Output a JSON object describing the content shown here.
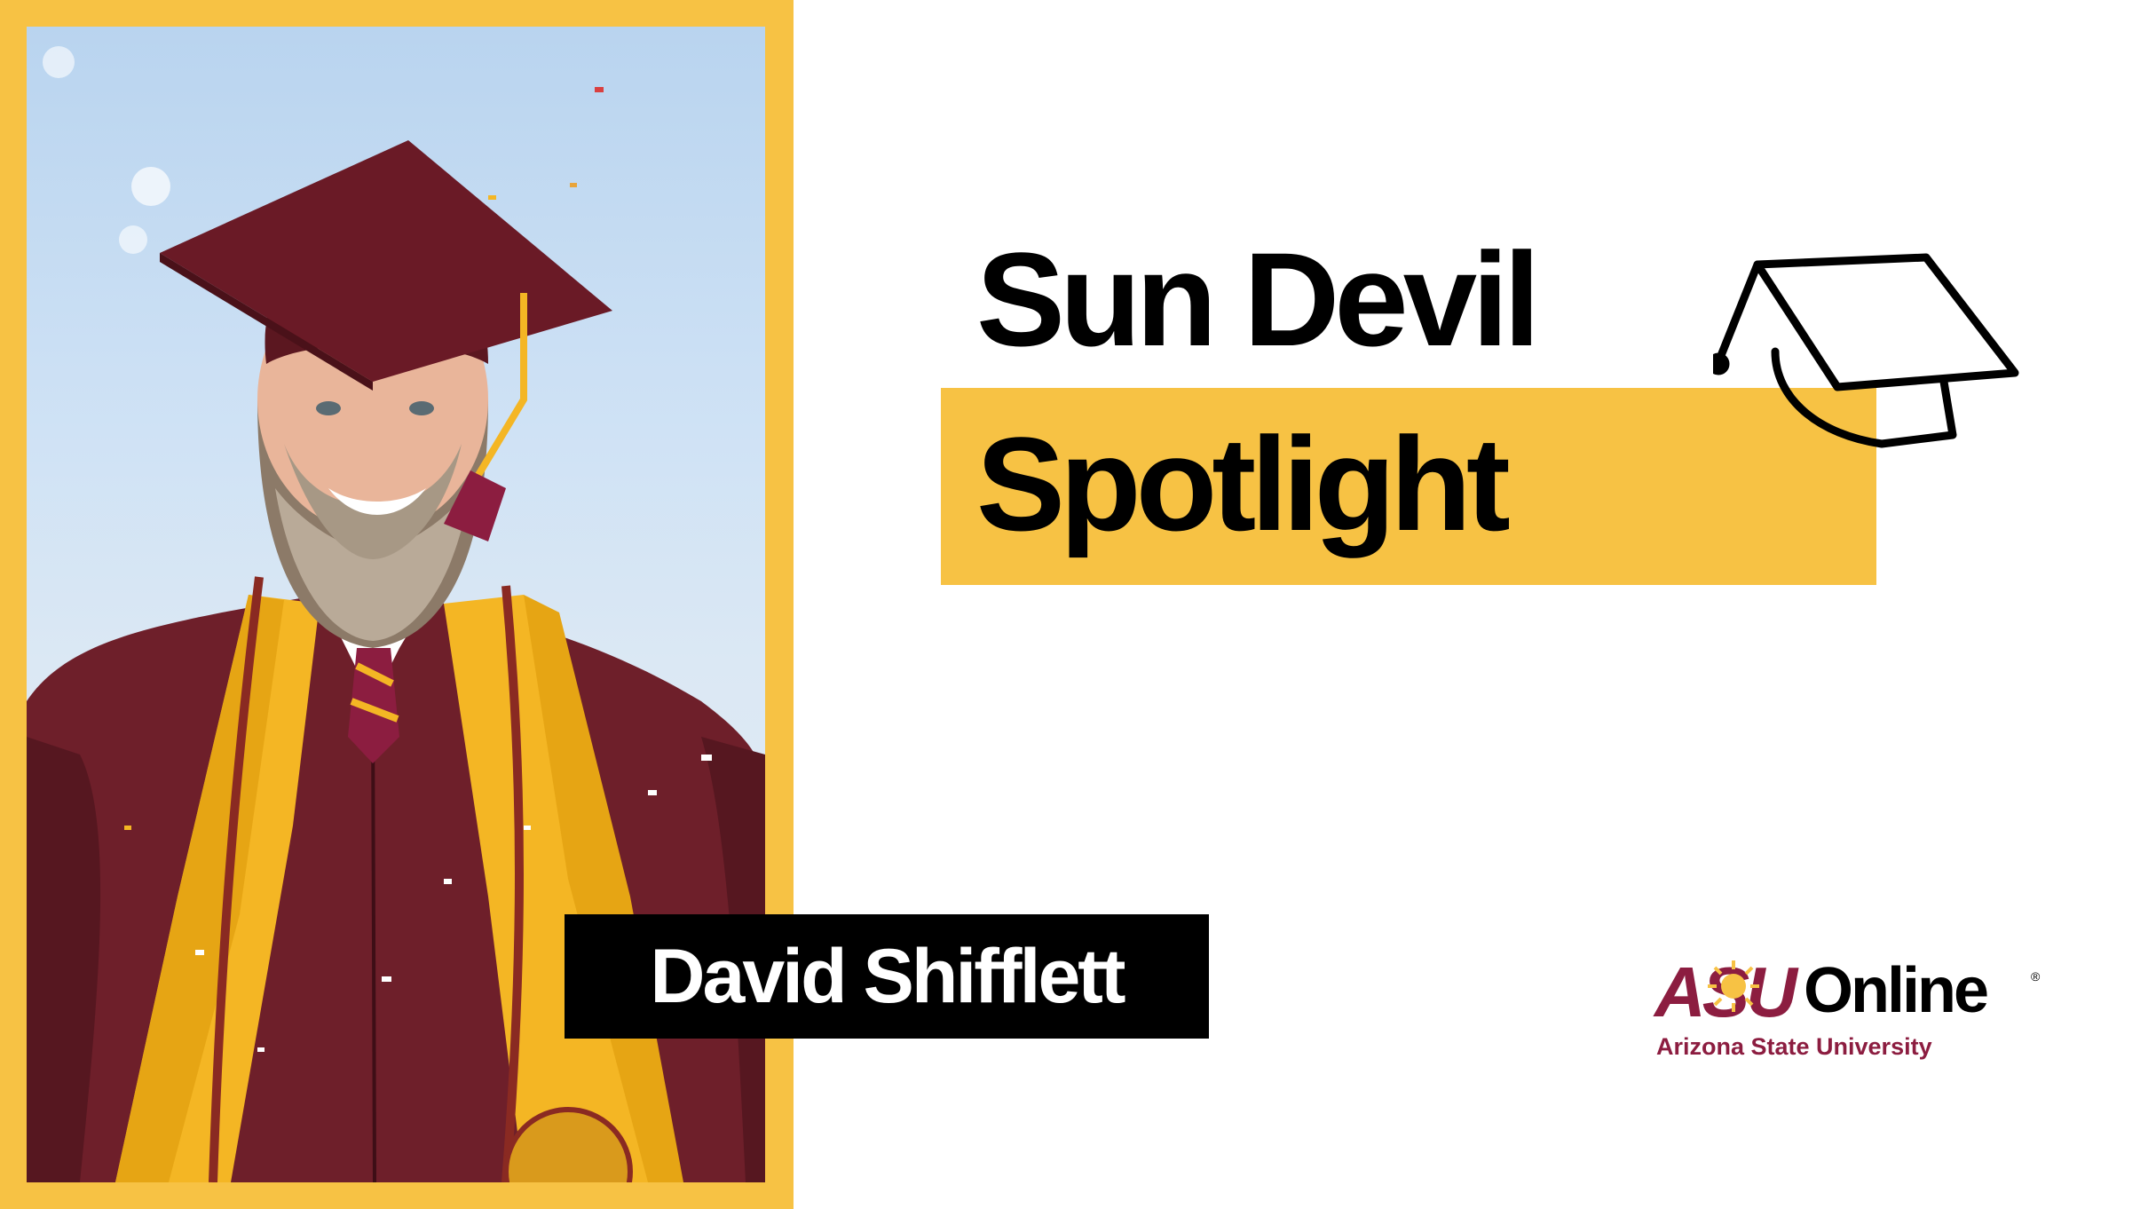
{
  "title": {
    "line1": "Sun Devil",
    "line2": "Spotlight"
  },
  "name": "David Shifflett",
  "logo": {
    "brand": "ASU",
    "product": "Online",
    "registered": "®",
    "subtitle": "Arizona State University"
  },
  "photo": {
    "subject": "graduate-portrait"
  },
  "colors": {
    "gold": "#f7c244",
    "maroon": "#8c1d40",
    "black": "#000000",
    "white": "#ffffff"
  },
  "icons": {
    "title": "graduation-cap-icon",
    "logo": "sunburst-icon"
  }
}
